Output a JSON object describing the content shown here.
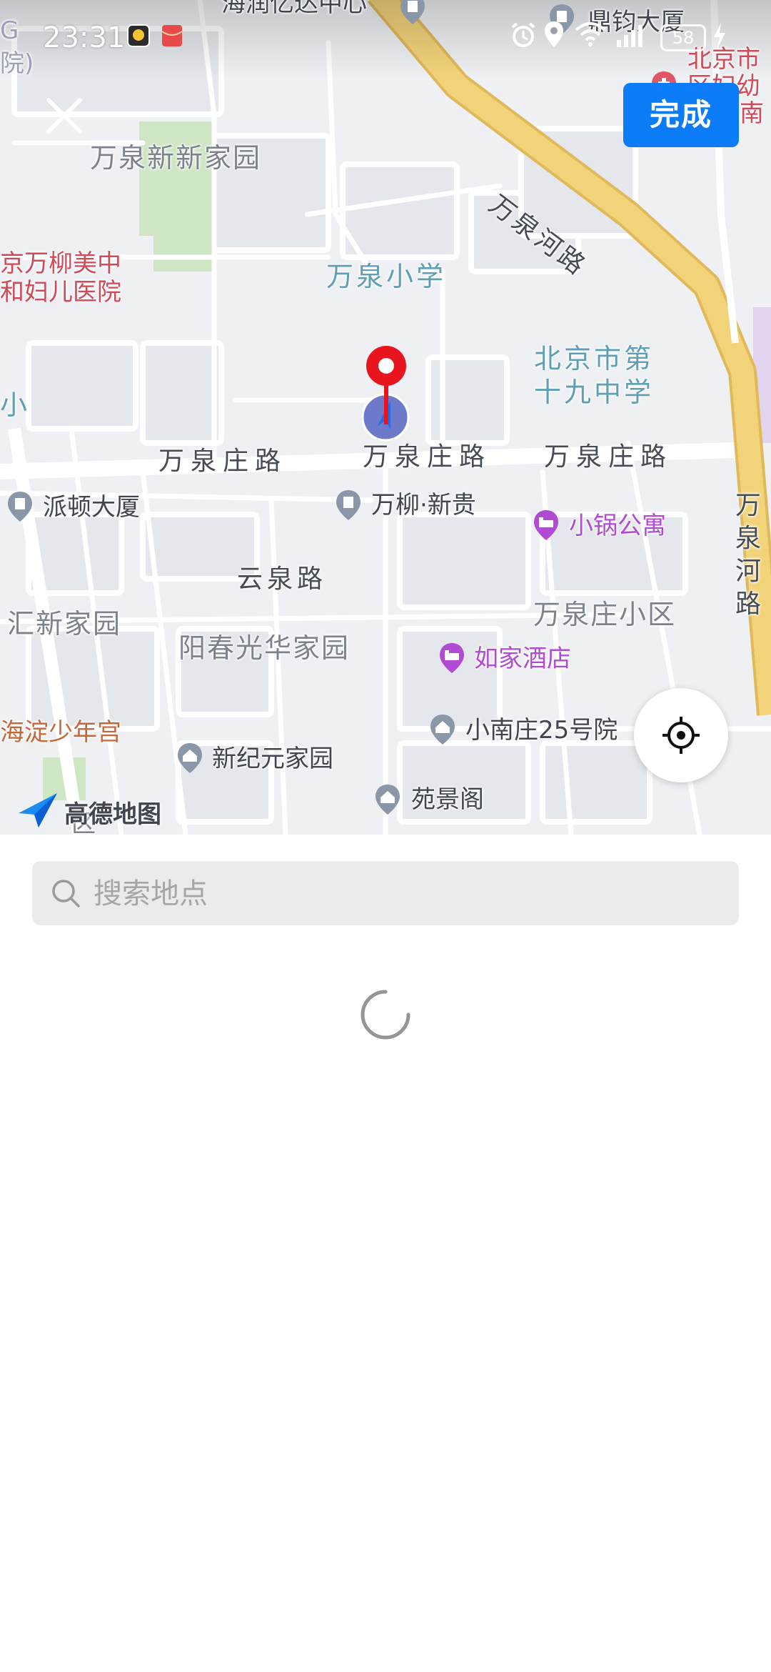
{
  "status_bar": {
    "time": "23:31",
    "battery": "58",
    "icons": [
      "app-notification-icon",
      "red-envelope-icon",
      "alarm-icon",
      "location-icon",
      "wifi-icon",
      "signal-icon",
      "battery-icon",
      "charging-icon"
    ]
  },
  "header": {
    "close_icon": "close-icon",
    "done_label": "完成"
  },
  "map": {
    "roads": {
      "wanquanzhuang_1": "万泉庄路",
      "wanquanzhuang_2": "万泉庄路",
      "wanquanzhuang_3": "万泉庄路",
      "wanquanhe_diag": "万泉河路",
      "wanquanhe_vert": "万泉河路",
      "yunquan": "云泉路"
    },
    "areas": {
      "wanquan_xinxin": "万泉新新家园",
      "wanquan_xiaoqu": "万泉庄小区",
      "yangchun": "阳春光华家园",
      "huixin": "汇新家园"
    },
    "schools": {
      "wanquan_primary": "万泉小学",
      "beijing_19_line1": "北京市第",
      "beijing_19_line2": "十九中学",
      "edge_xiao": "小"
    },
    "pois": {
      "haidian_yida": "海润亿达中心",
      "dingjun": "鼎钧大厦",
      "paidun": "派顿大厦",
      "wanliu_xingui": "万柳·新贵",
      "xiaonanzhuang": "小南庄25号院",
      "xinjiyuan": "新纪元家园",
      "yuanjingge": "苑景阁"
    },
    "hotels": {
      "xiaoguo": "小锅公寓",
      "rujia": "如家酒店"
    },
    "hospitals": {
      "wanliu_line1": "京万柳美中",
      "wanliu_line2": "和妇儿医院",
      "beijing_fuyou_line1": "北京市",
      "beijing_fuyou_line2": "区妇幼",
      "beijing_fuyou_line3": "南",
      "edge_g": "G",
      "edge_yuan": "院)"
    },
    "other": {
      "youth_palace": "海淀少年宫",
      "edge_district": "区"
    },
    "logo_text": "高德地图",
    "colors": {
      "main_road": "#f3d37a",
      "main_road_edge": "#e0b95a",
      "green": "#cfe6c4",
      "block": "#e6e9ed",
      "hotel": "#b14bd3",
      "pin": "#e8141e",
      "accent": "#0b7bf6"
    }
  },
  "search": {
    "placeholder": "搜索地点",
    "value": ""
  }
}
